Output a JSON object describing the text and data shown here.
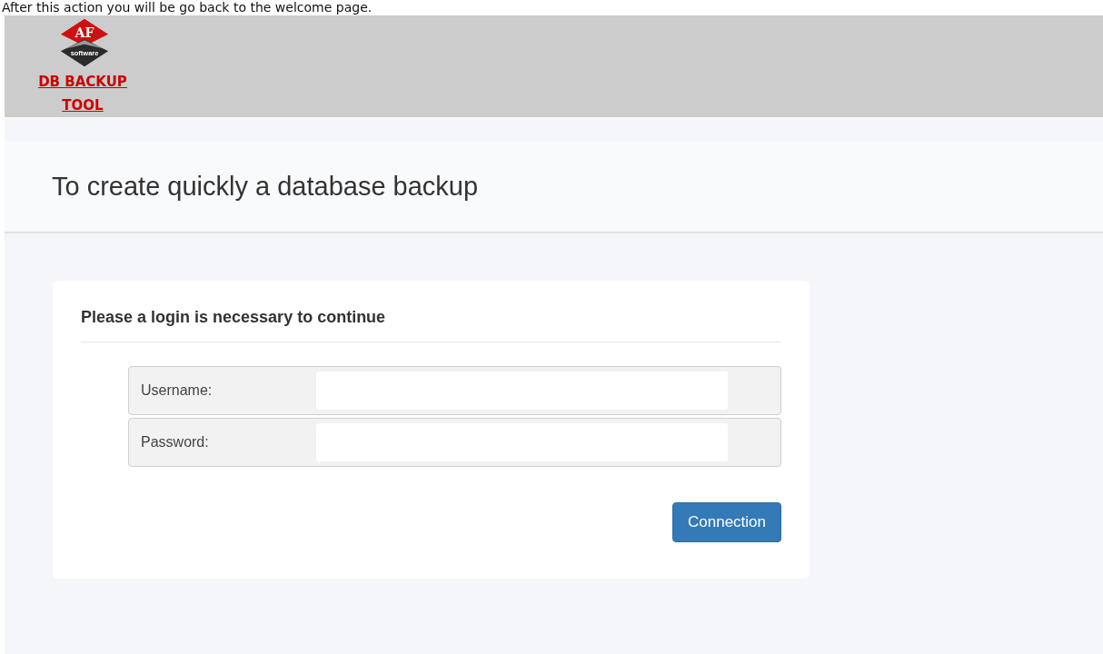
{
  "top_note": "After this action you will be go back to the welcome page.",
  "header": {
    "logo": {
      "letters": "AF",
      "caption": "software"
    },
    "app_link": [
      "DB BACKUP",
      "TOOL"
    ]
  },
  "page_title": "To create quickly a database backup",
  "login": {
    "title": "Please a login is necessary to continue",
    "fields": [
      {
        "label": "Username:"
      },
      {
        "label": "Password:"
      }
    ],
    "button": "Connection"
  }
}
